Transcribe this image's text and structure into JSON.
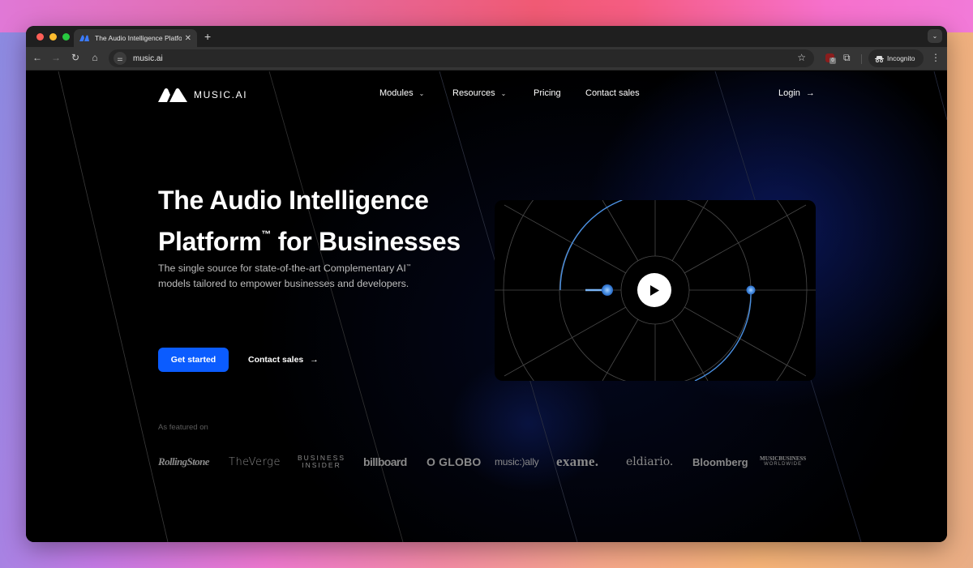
{
  "browser": {
    "tab": {
      "title": "The Audio Intelligence Platform for Businesses",
      "title_visible": "The Audio Intelligence Platfor",
      "close_glyph": "✕"
    },
    "new_tab_glyph": "+",
    "tab_menu_glyph": "⌄",
    "nav": {
      "back_glyph": "←",
      "forward_glyph": "→",
      "reload_glyph": "↻",
      "home_glyph": "⌂"
    },
    "address_bar": {
      "url": "music.ai",
      "site_info_glyph": "⚌",
      "bookmark_glyph": "☆"
    },
    "extensions": {
      "badge_count": "0",
      "puzzle_glyph": "⧉"
    },
    "profile": {
      "label": "Incognito",
      "icon_glyph": "🕶"
    },
    "menu_glyph": "⋮"
  },
  "site": {
    "brand": "MUSIC.AI",
    "brand_color": "#ffffff",
    "accent_color": "#0b5cff",
    "visual_accent_color": "#4a90e2",
    "nav": {
      "items": [
        {
          "label": "Modules",
          "has_dropdown": true
        },
        {
          "label": "Resources",
          "has_dropdown": true
        },
        {
          "label": "Pricing",
          "has_dropdown": false
        },
        {
          "label": "Contact sales",
          "has_dropdown": false
        }
      ],
      "chevron_glyph": "⌄",
      "login_label": "Login",
      "arrow_glyph": "→"
    },
    "hero": {
      "title_line1": "The Audio Intelligence",
      "title_line2_a": "Platform",
      "title_tm": "™",
      "title_line2_b": " for Businesses",
      "subtitle_a": "The single source for state-of-the-art Complementary AI",
      "subtitle_tm": "™",
      "subtitle_b": " models tailored to empower businesses and developers.",
      "primary_cta": "Get started",
      "secondary_cta": "Contact sales",
      "secondary_arrow": "→"
    },
    "player": {
      "play_label": "Play",
      "play_glyph": "▶"
    },
    "featured": {
      "label": "As featured on",
      "logos": [
        {
          "name": "Rolling Stone",
          "text": "RollingStone"
        },
        {
          "name": "The Verge",
          "text": "TheVerge"
        },
        {
          "name": "Business Insider",
          "line1": "BUSINESS",
          "line2": "INSIDER"
        },
        {
          "name": "Billboard",
          "text": "billboard"
        },
        {
          "name": "O Globo",
          "text": "O GLOBO"
        },
        {
          "name": "Music Ally",
          "text": "music:)ally"
        },
        {
          "name": "Exame",
          "text": "exame."
        },
        {
          "name": "elDiario",
          "text": "eldiario."
        },
        {
          "name": "Bloomberg",
          "text": "Bloomberg"
        },
        {
          "name": "Music Business Worldwide",
          "line1": "MUSICBUSINESS",
          "line2": "WORLDWIDE"
        }
      ]
    }
  }
}
